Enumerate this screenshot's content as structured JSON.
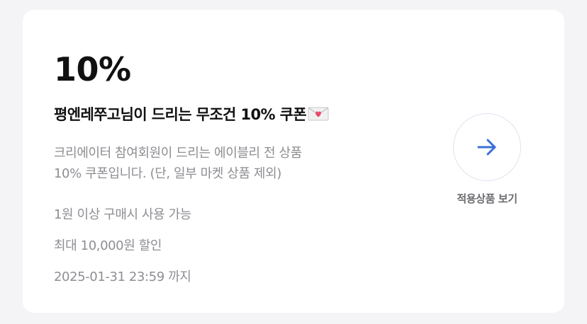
{
  "coupon": {
    "discount": "10%",
    "title": "평엔레쭈고님이 드리는 무조건 10% 쿠폰",
    "title_icon": "envelope-heart-icon",
    "description_line1": "크리에이터 참여회원이 드리는 에이블리 전 상품",
    "description_line2": "10% 쿠폰입니다. (단, 일부 마켓 상품 제외)",
    "min_purchase": "1원 이상 구매시 사용 가능",
    "max_discount": "최대 10,000원 할인",
    "expiry": "2025-01-31 23:59 까지"
  },
  "action": {
    "label": "적용상품 보기",
    "icon": "arrow-right-icon"
  },
  "colors": {
    "accent": "#3b6fd9",
    "heart": "#e84a6a",
    "text_primary": "#111111",
    "text_secondary": "#8e8e93"
  }
}
